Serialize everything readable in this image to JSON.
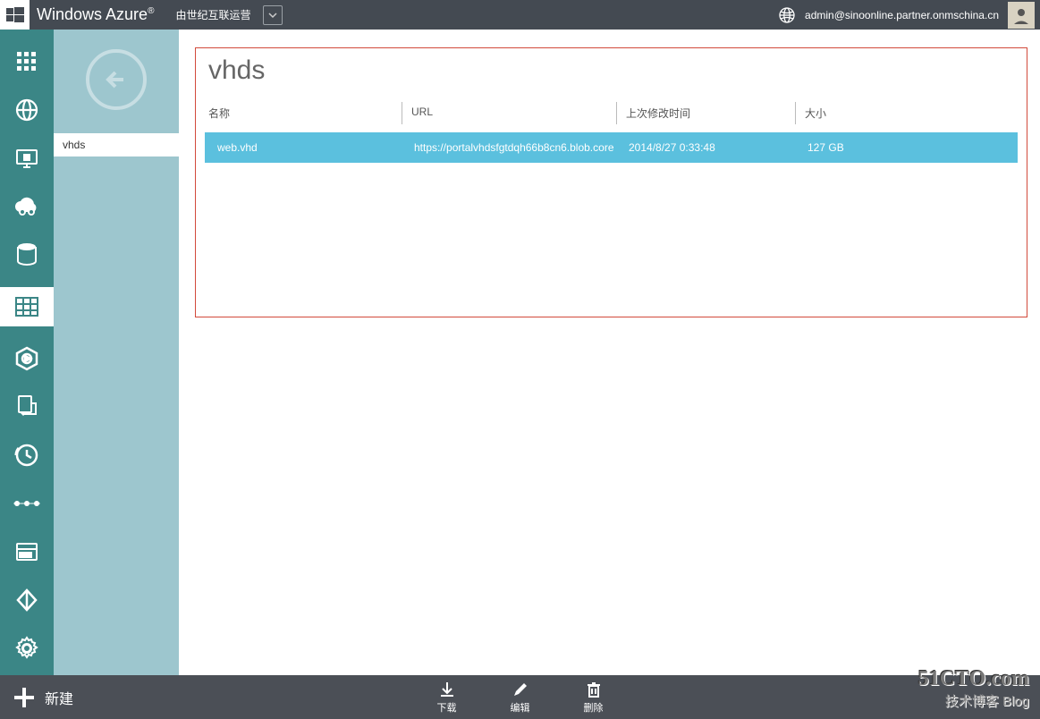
{
  "header": {
    "brand": "Windows Azure",
    "subbrand": "由世纪互联运营",
    "user_email": "admin@sinoonline.partner.onmschina.cn"
  },
  "sidebar2": {
    "tab_label": "vhds"
  },
  "main": {
    "title": "vhds",
    "columns": {
      "name": "名称",
      "url": "URL",
      "modified": "上次修改时间",
      "size": "大小"
    },
    "rows": [
      {
        "name": "web.vhd",
        "url": "https://portalvhdsfgtdqh66b8cn6.blob.core",
        "modified": "2014/8/27 0:33:48",
        "size": "127 GB"
      }
    ]
  },
  "bottombar": {
    "new_label": "新建",
    "actions": {
      "download": "下载",
      "edit": "编辑",
      "delete": "删除"
    }
  },
  "watermark": {
    "line1": "51CTO.com",
    "line2": "技术博客  Blog"
  }
}
